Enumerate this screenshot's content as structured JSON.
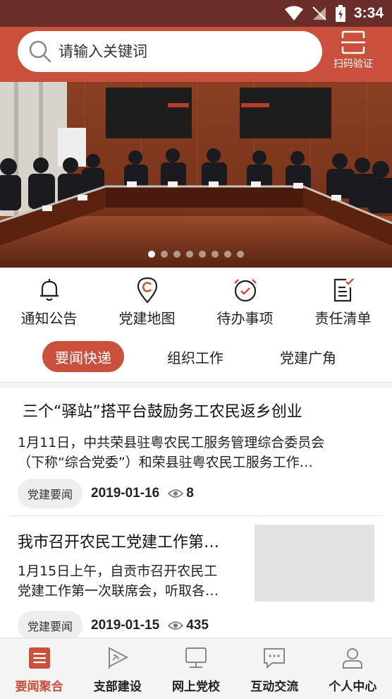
{
  "status_bar": {
    "time": "3:34"
  },
  "search": {
    "placeholder": "请输入关键词"
  },
  "scan": {
    "label": "扫码验证"
  },
  "banner": {
    "slide_count": 8,
    "active_index": 0
  },
  "quick_menu": [
    {
      "label": "通知公告",
      "icon": "bell-icon"
    },
    {
      "label": "党建地图",
      "icon": "map-pin-icon"
    },
    {
      "label": "待办事项",
      "icon": "alarm-clock-icon"
    },
    {
      "label": "责任清单",
      "icon": "checklist-icon"
    }
  ],
  "tabs": [
    {
      "label": "要闻快递",
      "active": true
    },
    {
      "label": "组织工作",
      "active": false
    },
    {
      "label": "党建广角",
      "active": false
    }
  ],
  "articles": [
    {
      "title": "三个“驿站”搭平台鼓励务工农民返乡创业",
      "summary_line1": "1月11日，中共荣县驻粤农民工服务管理综合委员会",
      "summary_line2": "（下称“综合党委”）和荣县驻粤农民工服务工作…",
      "tag": "党建要闻",
      "date": "2019-01-16",
      "views": "8"
    },
    {
      "title": "我市召开农民工党建工作第…",
      "summary_line1": "1月15日上午，自贡市召开农民工",
      "summary_line2": "党建工作第一次联席会，听取各…",
      "tag": "党建要闻",
      "date": "2019-01-15",
      "views": "435"
    }
  ],
  "bottom_nav": [
    {
      "label": "要闻聚合",
      "icon": "news-icon",
      "active": true
    },
    {
      "label": "支部建设",
      "icon": "party-flag-icon",
      "active": false
    },
    {
      "label": "网上党校",
      "icon": "monitor-icon",
      "active": false
    },
    {
      "label": "互动交流",
      "icon": "chat-icon",
      "active": false
    },
    {
      "label": "个人中心",
      "icon": "user-icon",
      "active": false
    }
  ],
  "colors": {
    "primary": "#c9503c",
    "status_bar": "#6b2d2a"
  }
}
